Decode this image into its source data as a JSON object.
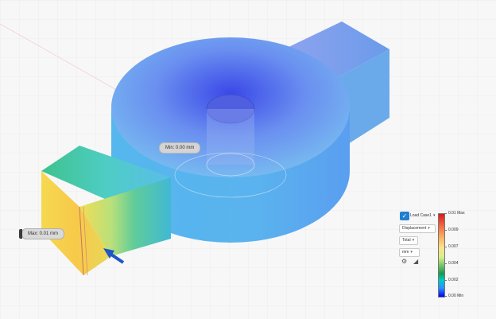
{
  "probes": {
    "min_label": "Min: 0.00 mm",
    "max_label": "Max: 0.01 mm"
  },
  "panel": {
    "load_case": "Load Case1",
    "result_type": "Displacement",
    "component": "Total",
    "unit": "mm",
    "icons": [
      "settings-icon",
      "adjust-icon"
    ]
  },
  "legend": {
    "labels": [
      "0.01 Max",
      "0.009",
      "0.007",
      "0.004",
      "0.002",
      "0.00 Min"
    ],
    "colors": [
      "#d7191c",
      "#fdae61",
      "#d9ef8b",
      "#1a9850",
      "#00cccc",
      "#0000ff"
    ]
  }
}
